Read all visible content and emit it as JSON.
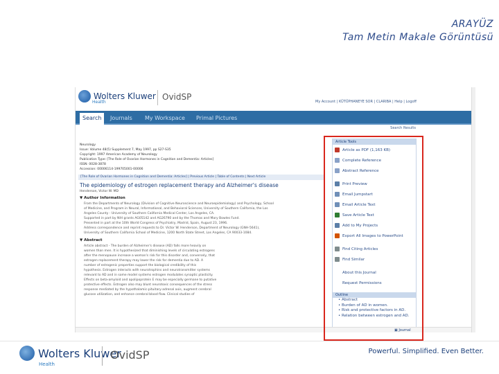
{
  "slide": {
    "title_line1": "ARAYÜZ",
    "title_line2": "Tam Metin Makale Görüntüsü"
  },
  "app": {
    "brand": "Wolters Kluwer",
    "brand_sub": "Health",
    "product": "OvidSP",
    "top_links": "My Account  |  KÜTÜPHANEYE SOR  |  CLARIBA  |  Help  |  Logoff",
    "tabs": [
      {
        "label": "Search"
      },
      {
        "label": "Journals"
      },
      {
        "label": "My Workspace"
      },
      {
        "label": "Primal Pictures"
      }
    ],
    "search_results_link": "Search Results"
  },
  "article": {
    "meta_lines": [
      "Neurology",
      "Issue: Volume 48(5) Supplement 7, May 1997, pp S27-S35",
      "Copyright: 1997 American Academy of Neurology",
      "Publication Type: [The Role of Ovarian Hormones in Cognition and Dementia: Articles]",
      "ISSN: 0028-3878",
      "Accession: 00006114-199705001-00006"
    ],
    "nav_strip": "[The Role of Ovarian Hormones in Cognition and Dementia: Articles] | Previous Article | Table of Contents | Next Article",
    "title": "The epidemiology of estrogen replacement therapy and Alzheimer's disease",
    "author": "Henderson, Victor W. MD",
    "author_info_heading": "Author Information",
    "author_info_lines": [
      "From the Departments of Neurology (Division of Cognitive Neuroscience and Neuroepidemiology) and Psychology, School",
      "of Medicine, and Program in Neural, Informational, and Behavioral Sciences, University of Southern California, the Los",
      "Angeles County - University of Southern California Medical Center, Los Angeles, CA.",
      "Supported in part by NIH grants AG05142 and AG26790 and by the Thomas and Mary Bowles Fund.",
      "Presented in part at the 10th World Congress of Psychiatry, Madrid, Spain, August 23, 1996.",
      "Address correspondence and reprint requests to Dr. Victor W. Henderson, Department of Neurology (GNH-5641),",
      "University of Southern California School of Medicine, 1200 North State Street, Los Angeles, CA 90033-1084."
    ],
    "abstract_heading": "Abstract",
    "abstract_lines": [
      "Article abstract - The burden of Alzheimer's disease (AD) falls more heavily on",
      "women than men. It is hypothesized that diminishing levels of circulating estrogens",
      "after the menopause increase a woman's risk for this disorder and, conversely, that",
      "estrogen replacement therapy may lower the risk for dementia due to AD. A",
      "number of estrogenic properties support the biological credibility of this",
      "hypothesis. Estrogen interacts with neurotrophins and neurotransmitter systems",
      "relevant to AD and in some model systems estrogen modulates synaptic plasticity.",
      "Effects on beta-amyloid and apolipoprotein E may be especially germane to putative",
      "protective effects. Estrogen also may blunt neurotoxic consequences of the stress",
      "response mediated by the hypothalamic-pituitary-adrenal axis, augment cerebral",
      "glucose utilization, and enhance cerebral blood flow. Clinical studies of"
    ]
  },
  "tools": {
    "heading": "Article Tools",
    "items": [
      {
        "label": "Article as PDF (1,163 KB)",
        "icon": "pdf-icon",
        "color": "#c0392b"
      },
      {
        "label": "Complete Reference",
        "icon": "document-icon",
        "color": "#8aa2c8"
      },
      {
        "label": "Abstract Reference",
        "icon": "document-icon",
        "color": "#8aa2c8"
      },
      {
        "label": "Print Preview",
        "icon": "print-icon",
        "color": "#5b7fa8"
      },
      {
        "label": "Email Jumpstart",
        "icon": "email-icon",
        "color": "#6f8fb8"
      },
      {
        "label": "Email Article Text",
        "icon": "email-icon",
        "color": "#6f8fb8"
      },
      {
        "label": "Save Article Text",
        "icon": "save-icon",
        "color": "#2e7d32"
      },
      {
        "label": "Add to My Projects",
        "icon": "projects-icon",
        "color": "#5b7fa8"
      },
      {
        "label": "Export All Images to PowerPoint",
        "icon": "powerpoint-icon",
        "color": "#d35400"
      },
      {
        "label": "Find Citing Articles",
        "icon": "search-icon",
        "color": "#7f8c8d"
      },
      {
        "label": "Find Similar",
        "icon": "search-icon",
        "color": "#7f8c8d"
      },
      {
        "label": "About this Journal",
        "icon": "none",
        "color": "#ffffff"
      },
      {
        "label": "Request Permissions",
        "icon": "none",
        "color": "#ffffff"
      }
    ]
  },
  "outline": {
    "heading": "Outline",
    "items": [
      "Abstract",
      "Burden of AD in women.",
      "Risk and protective factors in AD.",
      "Relation between estrogen and AD."
    ]
  },
  "bottom_bar": "Journal",
  "footer": {
    "brand": "Wolters Kluwer",
    "brand_sub": "Health",
    "product": "OvidSP",
    "slogan": "Powerful. Simplified. Even Better."
  },
  "colors": {
    "accent": "#2e6da4",
    "highlight": "#d9261c",
    "brand": "#1b3f7a"
  }
}
